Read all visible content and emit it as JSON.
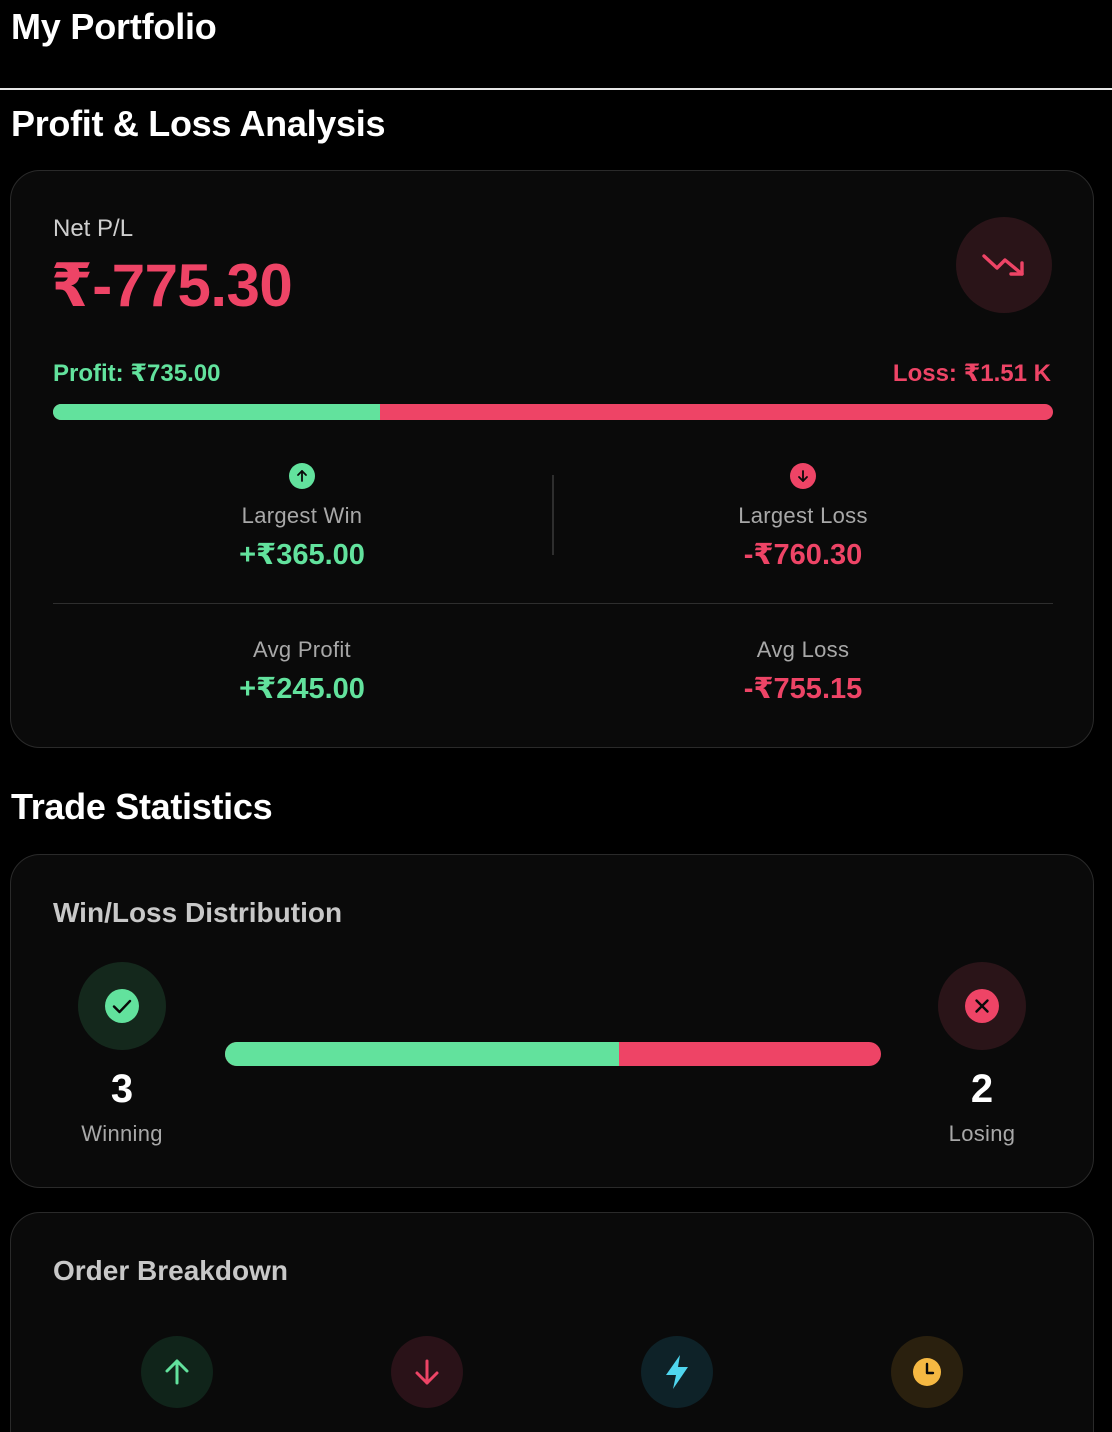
{
  "app": {
    "title": "My Portfolio"
  },
  "pl_section": {
    "title": "Profit & Loss Analysis"
  },
  "pl_card": {
    "net_label": "Net P/L",
    "net_value": "₹-775.30",
    "trend_icon": "trending-down-icon",
    "profit_label": "Profit: ₹735.00",
    "loss_label": "Loss: ₹1.51 K",
    "profit_fraction": 0.327,
    "largest_win": {
      "icon": "arrow-up-circle-icon",
      "label": "Largest Win",
      "value": "+₹365.00"
    },
    "largest_loss": {
      "icon": "arrow-down-circle-icon",
      "label": "Largest Loss",
      "value": "-₹760.30"
    },
    "avg_profit": {
      "label": "Avg Profit",
      "value": "+₹245.00"
    },
    "avg_loss": {
      "label": "Avg Loss",
      "value": "-₹755.15"
    }
  },
  "trade_section": {
    "title": "Trade Statistics"
  },
  "win_loss": {
    "title": "Win/Loss Distribution",
    "winning": {
      "count": "3",
      "label": "Winning",
      "icon": "check-circle-icon"
    },
    "losing": {
      "count": "2",
      "label": "Losing",
      "icon": "x-circle-icon"
    },
    "win_fraction": 0.6
  },
  "order_breakdown": {
    "title": "Order Breakdown",
    "icons": [
      "arrow-up-icon",
      "arrow-down-icon",
      "lightning-icon",
      "clock-icon"
    ]
  },
  "colors": {
    "background": "#000000",
    "card": "#0a0a0a",
    "profit": "#62e29d",
    "loss": "#ee4466",
    "cyan": "#4fd6ee",
    "amber": "#f5b842"
  }
}
